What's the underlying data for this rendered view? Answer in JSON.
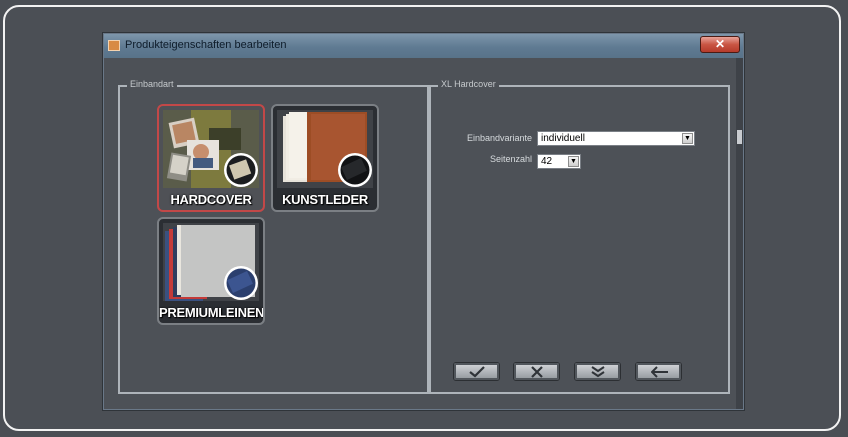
{
  "window": {
    "title": "Produkteigenschaften bearbeiten",
    "close_glyph": "✕"
  },
  "left_panel": {
    "legend": "Einbandart",
    "tiles": [
      {
        "label": "HARDCOVER",
        "selected": true
      },
      {
        "label": "KUNSTLEDER",
        "selected": false
      },
      {
        "label": "PREMIUMLEINEN",
        "selected": false
      }
    ]
  },
  "right_panel": {
    "legend": "XL Hardcover",
    "einbandvariante": {
      "label": "Einbandvariante",
      "value": "individuell"
    },
    "seitenzahl": {
      "label": "Seitenzahl",
      "value": "42"
    }
  },
  "actions": [
    {
      "icon": "checkmark-icon"
    },
    {
      "icon": "cross-icon"
    },
    {
      "icon": "chevrons-down-icon"
    },
    {
      "icon": "back-arrow-icon"
    }
  ],
  "colors": {
    "background": "#4a4e54",
    "titlebar": "#6a849b",
    "selected_border": "#c24848",
    "close_button": "#c95543"
  }
}
